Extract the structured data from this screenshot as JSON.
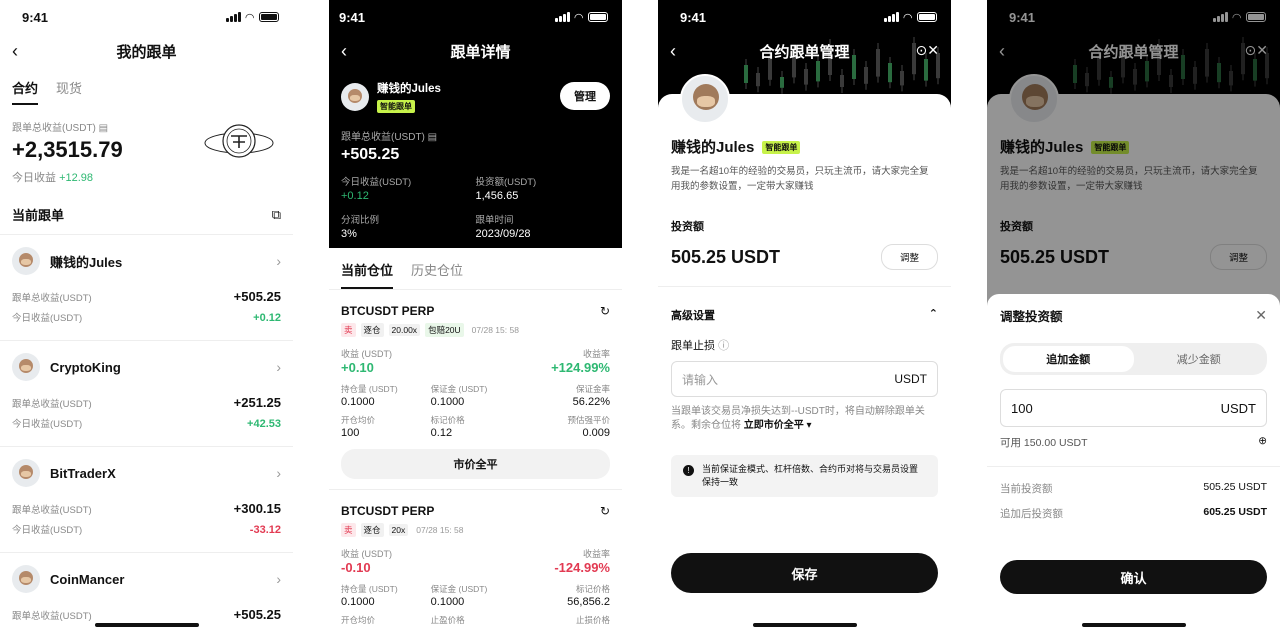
{
  "status_time": "9:41",
  "s1": {
    "title": "我的跟单",
    "tabs": [
      "合约",
      "现货"
    ],
    "total_label": "跟单总收益(USDT)",
    "total_value": "+2,3515.79",
    "today_label": "今日收益",
    "today_value": "+12.98",
    "section_title": "当前跟单",
    "traders": [
      {
        "name": "赚钱的Jules",
        "total_label": "跟单总收益(USDT)",
        "total": "+505.25",
        "today_label": "今日收益(USDT)",
        "today": "+0.12",
        "today_color": "green"
      },
      {
        "name": "CryptoKing",
        "total_label": "跟单总收益(USDT)",
        "total": "+251.25",
        "today_label": "今日收益(USDT)",
        "today": "+42.53",
        "today_color": "green"
      },
      {
        "name": "BitTraderX",
        "total_label": "跟单总收益(USDT)",
        "total": "+300.15",
        "today_label": "今日收益(USDT)",
        "today": "-33.12",
        "today_color": "red"
      },
      {
        "name": "CoinMancer",
        "total_label": "跟单总收益(USDT)",
        "total": "+505.25",
        "today_label": "",
        "today": "",
        "today_color": "green"
      }
    ]
  },
  "s2": {
    "title": "跟单详情",
    "name": "赚钱的Jules",
    "tag": "智能跟单",
    "manage": "管理",
    "total_label": "跟单总收益(USDT)",
    "total_value": "+505.25",
    "stats": [
      {
        "k": "今日收益(USDT)",
        "v": "+0.12"
      },
      {
        "k": "投资额(USDT)",
        "v": "1,456.65"
      },
      {
        "k": "分润比例",
        "v": "3%"
      },
      {
        "k": "跟单时间",
        "v": "2023/09/28"
      }
    ],
    "tabs": [
      "当前仓位",
      "历史仓位"
    ],
    "positions": [
      {
        "symbol": "BTCUSDT PERP",
        "side": "卖",
        "mode": "逐仓",
        "lev": "20.00x",
        "extra": "包赔20U",
        "time": "07/28 15: 58",
        "pnl_label": "收益 (USDT)",
        "pnl": "+0.10",
        "rate_label": "收益率",
        "rate": "+124.99%",
        "color": "green",
        "cells": [
          {
            "k": "持仓量 (USDT)",
            "v": "0.1000"
          },
          {
            "k": "保证金 (USDT)",
            "v": "0.1000"
          },
          {
            "k": "保证金率",
            "v": "56.22%"
          },
          {
            "k": "开仓均价",
            "v": "100"
          },
          {
            "k": "标记价格",
            "v": "0.12"
          },
          {
            "k": "预估强平价",
            "v": "0.009"
          }
        ],
        "button": "市价全平"
      },
      {
        "symbol": "BTCUSDT PERP",
        "side": "卖",
        "mode": "逐仓",
        "lev": "20x",
        "extra": "",
        "time": "07/28 15: 58",
        "pnl_label": "收益 (USDT)",
        "pnl": "-0.10",
        "rate_label": "收益率",
        "rate": "-124.99%",
        "color": "red",
        "cells": [
          {
            "k": "持仓量 (USDT)",
            "v": "0.1000"
          },
          {
            "k": "保证金 (USDT)",
            "v": "0.1000"
          },
          {
            "k": "标记价格",
            "v": "56,856.2"
          },
          {
            "k": "开仓均价",
            "v": ""
          },
          {
            "k": "止盈价格",
            "v": ""
          },
          {
            "k": "止损价格",
            "v": ""
          }
        ],
        "button": ""
      }
    ]
  },
  "s3": {
    "title": "合约跟单管理",
    "name": "赚钱的Jules",
    "tag": "智能跟单",
    "desc": "我是一名超10年的经验的交易员，只玩主流币，请大家完全复用我的参数设置，一定带大家赚钱",
    "invest_label": "投资额",
    "invest_value": "505.25 USDT",
    "adjust": "调整",
    "advanced": "高级设置",
    "stop_label": "跟单止损",
    "stop_placeholder": "请输入",
    "unit": "USDT",
    "note": "当跟单该交易员净损失达到--USDT时，将自动解除跟单关系。剩余仓位将",
    "note_action": "立即市价全平",
    "warning": "当前保证金模式、杠杆倍数、合约币对将与交易员设置保持一致",
    "save": "保存"
  },
  "s4": {
    "title": "合约跟单管理",
    "name": "赚钱的Jules",
    "tag": "智能跟单",
    "desc": "我是一名超10年的经验的交易员，只玩主流币，请大家完全复用我的参数设置，一定带大家赚钱",
    "invest_label": "投资额",
    "invest_value": "505.25 USDT",
    "adjust": "调整",
    "modal_title": "调整投资额",
    "seg": [
      "追加金额",
      "减少金额"
    ],
    "input_value": "100",
    "unit": "USDT",
    "avail": "可用 150.00 USDT",
    "current_label": "当前投资额",
    "current_value": "505.25 USDT",
    "after_label": "追加后投资额",
    "after_value": "605.25 USDT",
    "confirm": "确认"
  },
  "colors": {
    "green": "#2eb872",
    "red": "#e23a52",
    "tag": "#c7f24a"
  }
}
